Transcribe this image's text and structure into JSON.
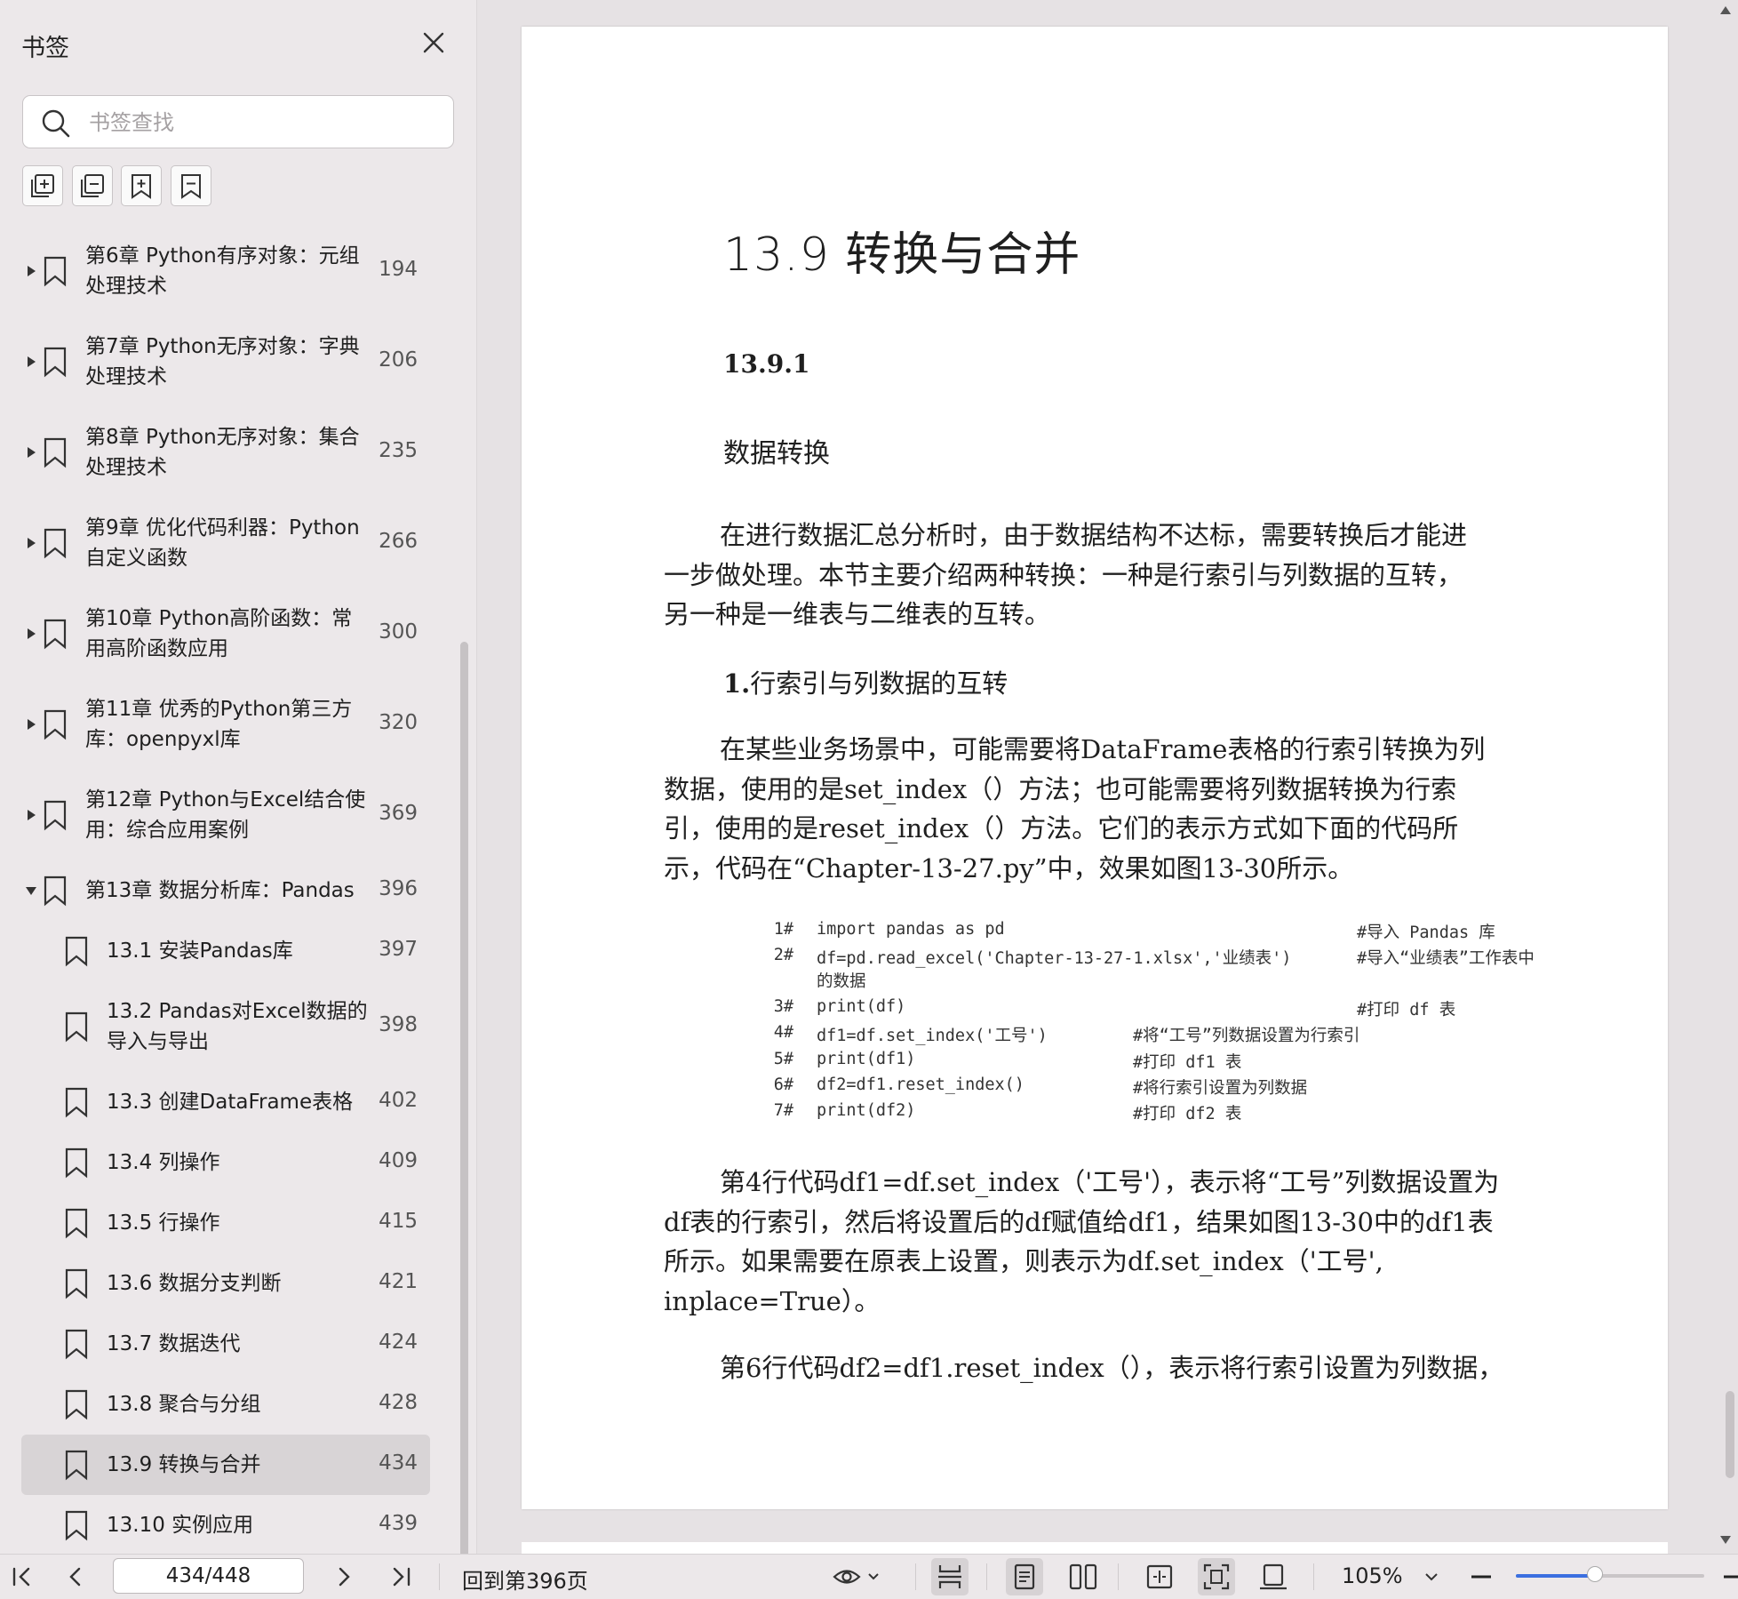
{
  "sidebar": {
    "title": "书签",
    "search_placeholder": "书签查找",
    "items": [
      {
        "lines": [
          "第6章 Python有序对象：元组",
          "处理技术"
        ],
        "page": "194",
        "level": 0,
        "expandable": true,
        "expanded": false
      },
      {
        "lines": [
          "第7章 Python无序对象：字典",
          "处理技术"
        ],
        "page": "206",
        "level": 0,
        "expandable": true,
        "expanded": false
      },
      {
        "lines": [
          "第8章 Python无序对象：集合",
          "处理技术"
        ],
        "page": "235",
        "level": 0,
        "expandable": true,
        "expanded": false
      },
      {
        "lines": [
          "第9章 优化代码利器：Python",
          "自定义函数"
        ],
        "page": "266",
        "level": 0,
        "expandable": true,
        "expanded": false
      },
      {
        "lines": [
          "第10章 Python高阶函数：常",
          "用高阶函数应用"
        ],
        "page": "300",
        "level": 0,
        "expandable": true,
        "expanded": false
      },
      {
        "lines": [
          "第11章 优秀的Python第三方",
          "库：openpyxl库"
        ],
        "page": "320",
        "level": 0,
        "expandable": true,
        "expanded": false
      },
      {
        "lines": [
          "第12章 Python与Excel结合使",
          "用：综合应用案例"
        ],
        "page": "369",
        "level": 0,
        "expandable": true,
        "expanded": false
      },
      {
        "lines": [
          "第13章 数据分析库：Pandas"
        ],
        "page": "396",
        "level": 0,
        "expandable": true,
        "expanded": true
      },
      {
        "lines": [
          "13.1 安装Pandas库"
        ],
        "page": "397",
        "level": 1,
        "expandable": false
      },
      {
        "lines": [
          "13.2 Pandas对Excel数据的",
          "导入与导出"
        ],
        "page": "398",
        "level": 1,
        "expandable": false
      },
      {
        "lines": [
          "13.3 创建DataFrame表格"
        ],
        "page": "402",
        "level": 1,
        "expandable": false
      },
      {
        "lines": [
          "13.4 列操作"
        ],
        "page": "409",
        "level": 1,
        "expandable": false
      },
      {
        "lines": [
          "13.5 行操作"
        ],
        "page": "415",
        "level": 1,
        "expandable": false
      },
      {
        "lines": [
          "13.6 数据分支判断"
        ],
        "page": "421",
        "level": 1,
        "expandable": false
      },
      {
        "lines": [
          "13.7 数据迭代"
        ],
        "page": "424",
        "level": 1,
        "expandable": false
      },
      {
        "lines": [
          "13.8 聚合与分组"
        ],
        "page": "428",
        "level": 1,
        "expandable": false
      },
      {
        "lines": [
          "13.9 转换与合并"
        ],
        "page": "434",
        "level": 1,
        "expandable": false,
        "active": true
      },
      {
        "lines": [
          "13.10 实例应用"
        ],
        "page": "439",
        "level": 1,
        "expandable": false
      }
    ]
  },
  "document": {
    "heading": "13.9 转换与合并",
    "subheading_num": "13.9.1",
    "subheading_text": "数据转换",
    "para1": [
      "在进行数据汇总分析时，由于数据结构不达标，需要转换后才能进",
      "一步做处理。本节主要介绍两种转换：一种是行索引与列数据的互转，",
      "另一种是一维表与二维表的互转。"
    ],
    "section1_num": "1.",
    "section1_text": "行索引与列数据的互转",
    "para2": [
      "在某些业务场景中，可能需要将DataFrame表格的行索引转换为列",
      "数据，使用的是set_index（）方法；也可能需要将列数据转换为行索",
      "引，使用的是reset_index（）方法。它们的表示方式如下面的代码所",
      "示，代码在“Chapter-13-27.py”中，效果如图13-30所示。"
    ],
    "code": [
      {
        "num": "1#",
        "code": "import pandas as pd",
        "comment": "#导入 Pandas 库",
        "comment_col": "wide"
      },
      {
        "num": "2#",
        "code": "df=pd.read_excel('Chapter-13-27-1.xlsx','业绩表')",
        "comment": "#导入“业绩表”工作表中",
        "comment_col": "wide"
      },
      {
        "num": "",
        "code": "的数据",
        "comment": "",
        "comment_col": "wide"
      },
      {
        "num": "3#",
        "code": "print(df)",
        "comment": "#打印 df 表",
        "comment_col": "wide"
      },
      {
        "num": "4#",
        "code": "df1=df.set_index('工号')",
        "comment": "#将“工号”列数据设置为行索引",
        "comment_col": "narrow"
      },
      {
        "num": "5#",
        "code": "print(df1)",
        "comment": "#打印 df1 表",
        "comment_col": "narrow"
      },
      {
        "num": "6#",
        "code": "df2=df1.reset_index()",
        "comment": "#将行索引设置为列数据",
        "comment_col": "narrow"
      },
      {
        "num": "7#",
        "code": "print(df2)",
        "comment": "#打印 df2 表",
        "comment_col": "narrow"
      }
    ],
    "para3": [
      "第4行代码df1=df.set_index（'工号'），表示将“工号”列数据设置为",
      "df表的行索引，然后将设置后的df赋值给df1，结果如图13-30中的df1表",
      "所示。如果需要在原表上设置，则表示为df.set_index（'工号',",
      "inplace=True）。"
    ],
    "para4": [
      "第6行代码df2=df1.reset_index（），表示将行索引设置为列数据，"
    ]
  },
  "toolbar": {
    "page_indicator": "434/448",
    "back_to": "回到第396页",
    "zoom": "105%",
    "zoom_slider_fraction": 0.42
  }
}
